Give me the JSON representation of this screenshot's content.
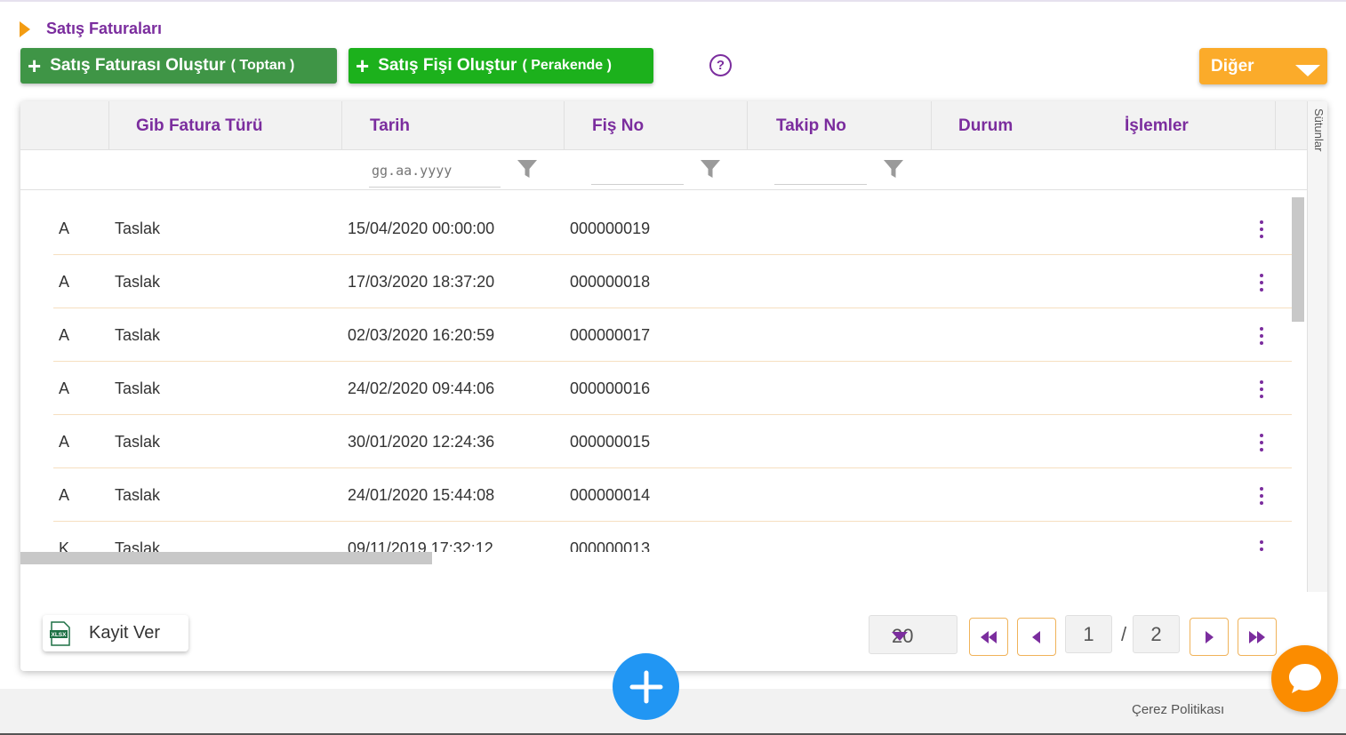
{
  "page": {
    "title": "Satış Faturaları"
  },
  "toolbar": {
    "create_invoice": {
      "label": "Satış Faturası Oluştur",
      "sub": "( Toptan )"
    },
    "create_receipt": {
      "label": "Satış Fişi Oluştur",
      "sub": "( Perakende )"
    },
    "help_symbol": "?",
    "other_label": "Diğer"
  },
  "table": {
    "columns": [
      "Gib Fatura Türü",
      "Tarih",
      "Fiş No",
      "Takip No",
      "Durum",
      "İşlemler"
    ],
    "side_tab": "Sütunlar",
    "filters": {
      "date_placeholder": "gg.aa.yyyy"
    },
    "rows": [
      {
        "type": "A",
        "gib": "Taslak",
        "date": "15/04/2020 00:00:00",
        "no": "000000019"
      },
      {
        "type": "A",
        "gib": "Taslak",
        "date": "17/03/2020 18:37:20",
        "no": "000000018"
      },
      {
        "type": "A",
        "gib": "Taslak",
        "date": "02/03/2020 16:20:59",
        "no": "000000017"
      },
      {
        "type": "A",
        "gib": "Taslak",
        "date": "24/02/2020 09:44:06",
        "no": "000000016"
      },
      {
        "type": "A",
        "gib": "Taslak",
        "date": "30/01/2020 12:24:36",
        "no": "000000015"
      },
      {
        "type": "A",
        "gib": "Taslak",
        "date": "24/01/2020 15:44:08",
        "no": "000000014"
      },
      {
        "type": "K",
        "gib": "Taslak",
        "date": "09/11/2019 17:32:12",
        "no": "000000013"
      }
    ]
  },
  "export": {
    "label": "Kayit Ver",
    "icon_text": "XLSX"
  },
  "pagination": {
    "page_size": "20",
    "current_page": "1",
    "separator": "/",
    "total_pages": "2"
  },
  "footer": {
    "cookie_label": "Çerez Politikası"
  },
  "colors": {
    "brand_purple": "#7b2d9e",
    "accent_orange": "#fbab2a",
    "green_dark": "#3f9546",
    "green_bright": "#1cb11c",
    "fab_blue": "#2196f3",
    "chat_orange": "#fb8c00"
  },
  "icons": [
    "help-icon",
    "filter-icon",
    "more-vertical-icon",
    "excel-icon",
    "first-page-icon",
    "prev-page-icon",
    "next-page-icon",
    "last-page-icon",
    "add-icon",
    "chat-icon"
  ]
}
